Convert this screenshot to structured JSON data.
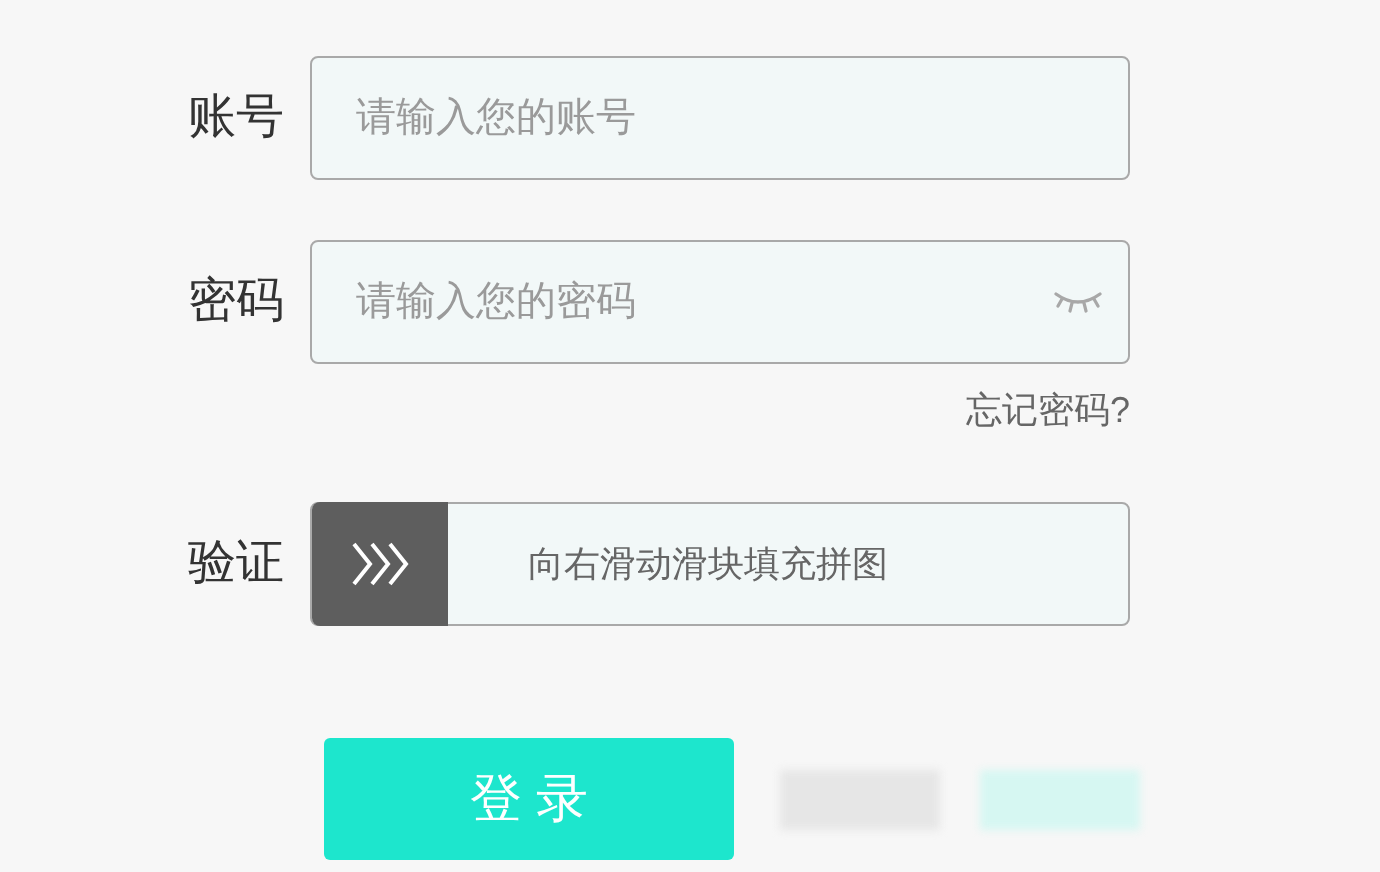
{
  "account": {
    "label": "账号",
    "placeholder": "请输入您的账号"
  },
  "password": {
    "label": "密码",
    "placeholder": "请输入您的密码"
  },
  "forgot_link": "忘记密码?",
  "verify": {
    "label": "验证",
    "hint": "向右滑动滑块填充拼图",
    "level": 0
  },
  "login_button": "登 录"
}
